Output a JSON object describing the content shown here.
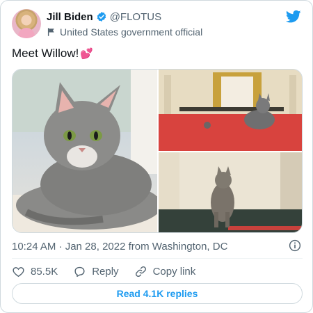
{
  "author": {
    "display_name": "Jill Biden",
    "handle": "@FLOTUS",
    "label": "United States government official",
    "avatar_icon": "profile-photo",
    "verified_icon": "verified-badge-icon"
  },
  "tweet": {
    "text": "Meet Willow!",
    "emoji": "💕",
    "timestamp": "10:24 AM · Jan 28, 2022 from Washington, DC",
    "photos": [
      "cat-on-windowsill",
      "cat-on-red-carpet-hall",
      "cat-walking-hallway"
    ]
  },
  "actions": {
    "likes": "85.5K",
    "reply_label": "Reply",
    "copy_label": "Copy link"
  },
  "read_replies_label": "Read 4.1K replies",
  "colors": {
    "brand": "#1d9bf0",
    "text": "#0f1419",
    "secondary": "#536471",
    "heart": "#e0245e"
  }
}
